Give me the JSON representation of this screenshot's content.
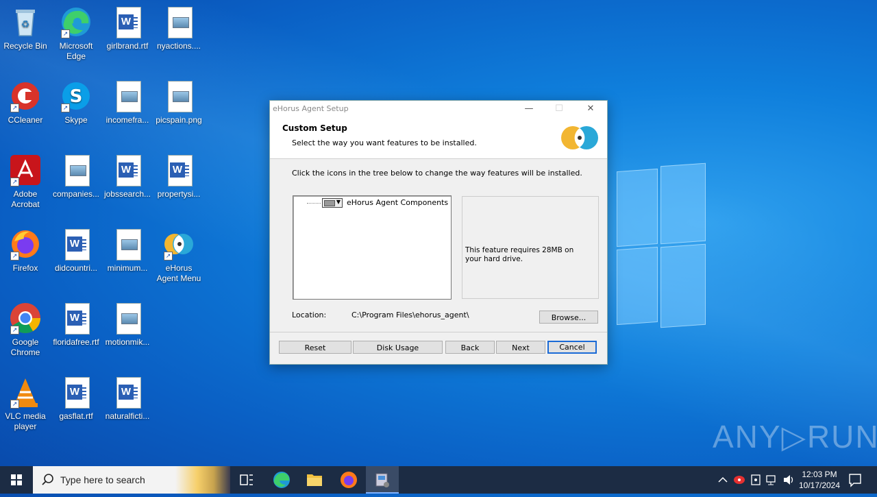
{
  "desktop": {
    "icons": [
      {
        "label": "Recycle Bin"
      },
      {
        "label": "Microsoft Edge"
      },
      {
        "label": "girlbrand.rtf"
      },
      {
        "label": "nyactions...."
      },
      {
        "label": "CCleaner"
      },
      {
        "label": "Skype"
      },
      {
        "label": "incomefra..."
      },
      {
        "label": "picspain.png"
      },
      {
        "label": "Adobe Acrobat"
      },
      {
        "label": "companies..."
      },
      {
        "label": "jobssearch..."
      },
      {
        "label": "propertysi..."
      },
      {
        "label": "Firefox"
      },
      {
        "label": "didcountri..."
      },
      {
        "label": "minimum..."
      },
      {
        "label": "eHorus Agent Menu"
      },
      {
        "label": "Google Chrome"
      },
      {
        "label": "floridafree.rtf"
      },
      {
        "label": "motionmik..."
      },
      {
        "label": "VLC media player"
      },
      {
        "label": "gasflat.rtf"
      },
      {
        "label": "naturalficti..."
      }
    ]
  },
  "dialog": {
    "title": "eHorus Agent Setup",
    "minimize": "—",
    "maximize": "☐",
    "close": "✕",
    "heading": "Custom Setup",
    "subheading": "Select the way you want features to be installed.",
    "instruction": "Click the icons in the tree below to change the way features will be installed.",
    "tree_item": "eHorus Agent Components",
    "feature_info": "This feature requires 28MB on your hard drive.",
    "location_label": "Location:",
    "location_value": "C:\\Program Files\\ehorus_agent\\",
    "buttons": {
      "browse": "Browse...",
      "reset": "Reset",
      "disk_usage": "Disk Usage",
      "back": "Back",
      "next": "Next",
      "cancel": "Cancel"
    },
    "colors": {
      "logo_yellow": "#f2b632",
      "logo_blue": "#2aa8d8",
      "focus_border": "#1a6ad6"
    }
  },
  "watermark": "ANY▷RUN",
  "taskbar": {
    "search_placeholder": "Type here to search",
    "time": "12:03 PM",
    "date": "10/17/2024"
  }
}
